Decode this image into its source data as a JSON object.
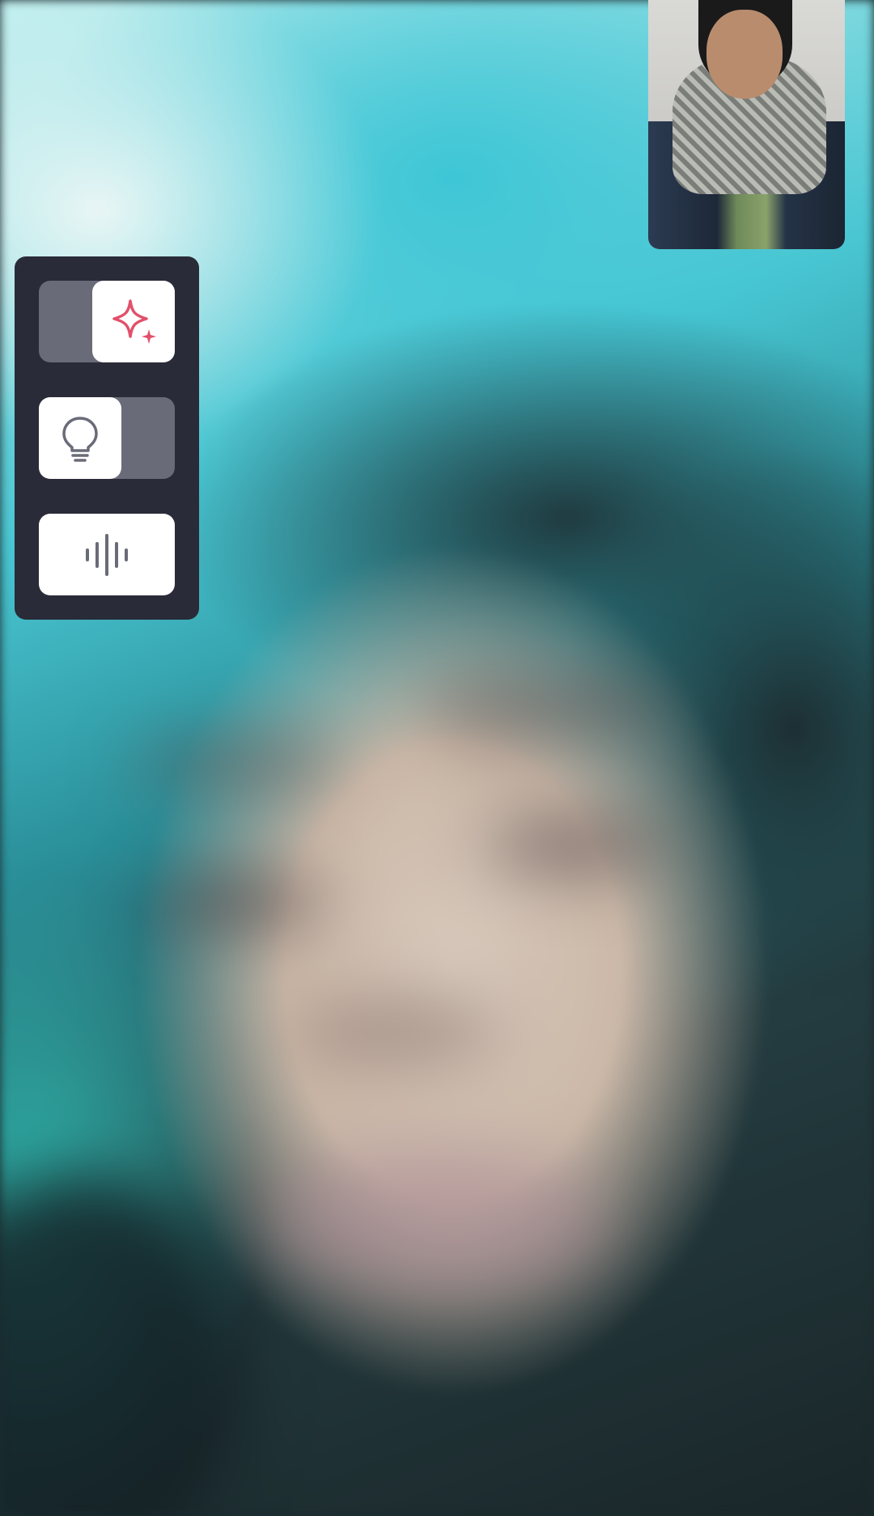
{
  "call": {
    "remote_video": {
      "icon": "remote-participant-video"
    },
    "self_preview": {
      "icon": "local-camera-preview"
    }
  },
  "effects_panel": {
    "controls": [
      {
        "id": "effects",
        "icon": "sparkle-icon",
        "state": "on",
        "accent": "#e2506a"
      },
      {
        "id": "lighting",
        "icon": "lightbulb-icon",
        "state": "off",
        "accent": "#6a6b78"
      },
      {
        "id": "audio",
        "icon": "sound-wave-icon",
        "accent": "#6a6b78"
      }
    ],
    "colors": {
      "panel_bg": "#2a2b38",
      "track_bg": "#6a6b78",
      "knob_bg": "#ffffff"
    }
  }
}
